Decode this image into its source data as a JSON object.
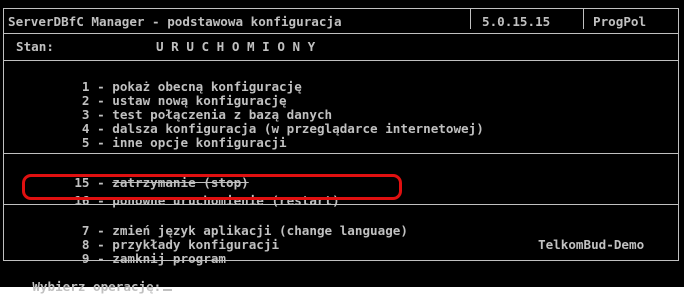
{
  "header": {
    "title": "ServerDBfC Manager - podstawowa konfiguracja",
    "version": "5.0.15.15",
    "vendor": "ProgPol"
  },
  "status": {
    "label": "Stan:",
    "value": "U R U C H O M I O N Y"
  },
  "menu_main": [
    {
      "key": "1",
      "label": "pokaż obecną konfigurację"
    },
    {
      "key": "2",
      "label": "ustaw nową konfigurację"
    },
    {
      "key": "3",
      "label": "test połączenia z bazą danych"
    },
    {
      "key": "4",
      "label": "dalsza konfiguracja (w przeglądarce internetowej)"
    },
    {
      "key": "5",
      "label": "inne opcje konfiguracji"
    }
  ],
  "menu_service": [
    {
      "key": "15",
      "label": "zatrzymanie (stop)"
    },
    {
      "key": "16",
      "label": "ponowne uruchomienie (restart)"
    }
  ],
  "menu_other": [
    {
      "key": "7",
      "label": "zmień język aplikacji (change language)"
    },
    {
      "key": "8",
      "label": "przykłady konfiguracji"
    },
    {
      "key": "9",
      "label": "zamknij program"
    }
  ],
  "license_name": "TelkomBud-Demo",
  "prompt": "Wybierz operację:",
  "colors": {
    "background": "#000000",
    "text": "#c0c0c0",
    "annotation": "#e01010"
  }
}
